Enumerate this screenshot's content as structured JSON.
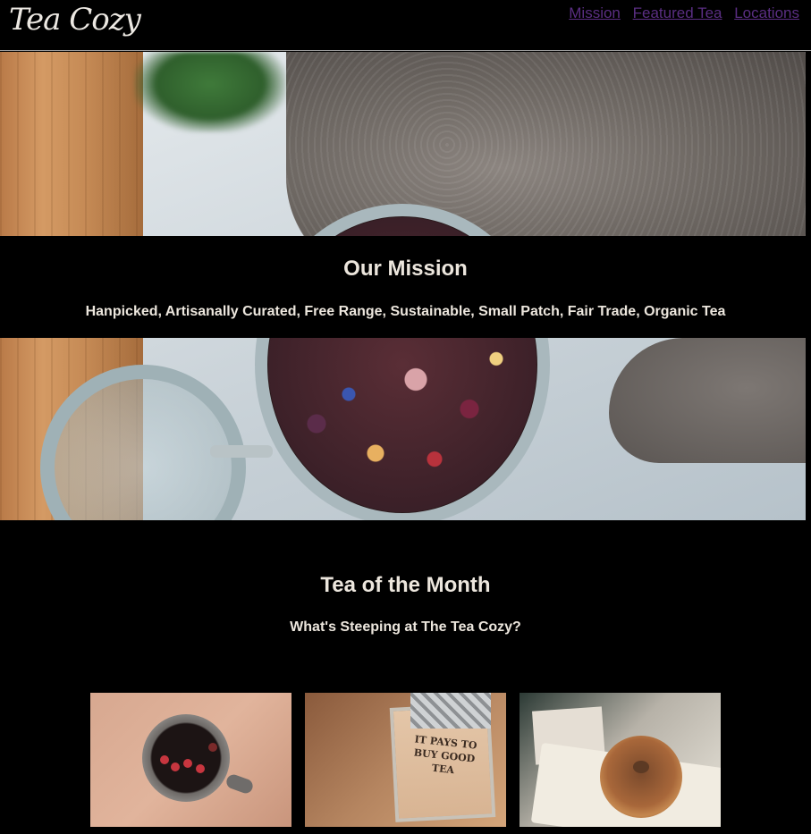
{
  "header": {
    "logo_text": "Tea Cozy",
    "nav": [
      {
        "label": "Mission"
      },
      {
        "label": "Featured Tea"
      },
      {
        "label": "Locations"
      }
    ]
  },
  "mission": {
    "title": "Our Mission",
    "subtitle": "Hanpicked, Artisanally Curated, Free Range, Sustainable, Small Patch, Fair Trade, Organic Tea"
  },
  "tea_of_month": {
    "title": "Tea of the Month",
    "subtitle": "What's Steeping at The Tea Cozy?",
    "crate_text": "IT PAYS TO BUY GOOD TEA"
  },
  "colors": {
    "background": "#000000",
    "text": "#ece6dd",
    "nav_link": "#5a2e82"
  },
  "icons": {
    "logo": "tea-cozy-logo"
  }
}
